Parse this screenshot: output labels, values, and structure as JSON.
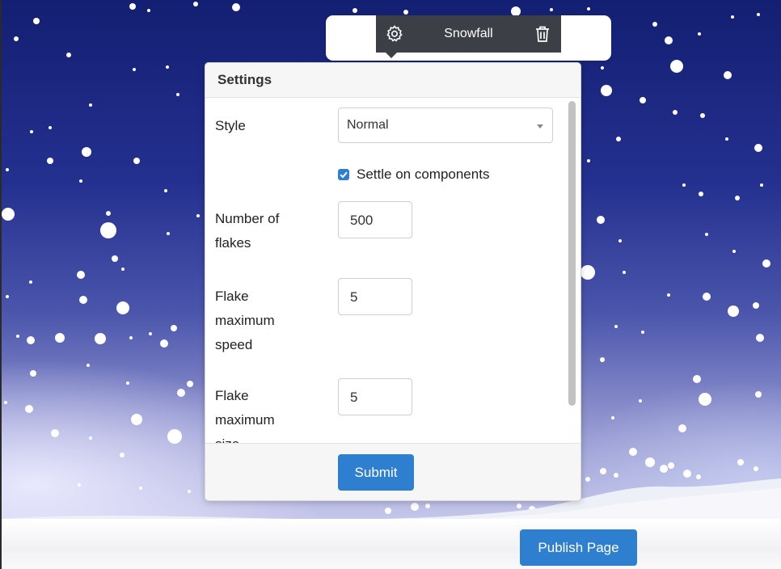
{
  "component_toolbar": {
    "title": "Snowfall",
    "settings_icon": "gear-icon",
    "delete_icon": "trash-icon"
  },
  "settings_panel": {
    "title": "Settings",
    "fields": {
      "style": {
        "label": "Style",
        "value": "Normal"
      },
      "settle": {
        "label": "Settle on components",
        "checked": true
      },
      "flakes": {
        "label": [
          "Number of",
          "flakes"
        ],
        "value": "500"
      },
      "speed": {
        "label": [
          "Flake",
          "maximum",
          "speed"
        ],
        "value": "5"
      },
      "size": {
        "label": [
          "Flake",
          "maximum",
          "size"
        ],
        "value": "5"
      }
    },
    "submit_label": "Submit"
  },
  "page": {
    "publish_label": "Publish Page"
  },
  "colors": {
    "sky_top": "#131f72",
    "toolbar_bg": "#3d3f47",
    "primary_button": "#2f7fd1",
    "checkbox": "#2d7fd3"
  }
}
